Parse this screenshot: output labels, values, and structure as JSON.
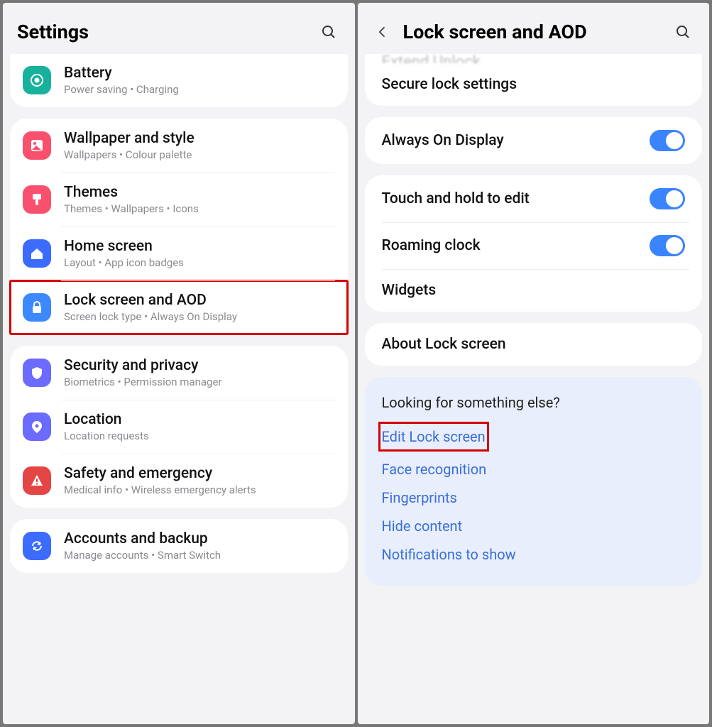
{
  "left": {
    "title": "Settings",
    "items": [
      {
        "id": "battery",
        "label": "Battery",
        "sub": "Power saving  •  Charging",
        "icon": "battery",
        "color": "bg-teal",
        "group": 0
      },
      {
        "id": "wallpaper",
        "label": "Wallpaper and style",
        "sub": "Wallpapers  •  Colour palette",
        "icon": "image",
        "color": "bg-pink",
        "group": 1
      },
      {
        "id": "themes",
        "label": "Themes",
        "sub": "Themes  •  Wallpapers  •  Icons",
        "icon": "brush",
        "color": "bg-pink2",
        "group": 1
      },
      {
        "id": "home",
        "label": "Home screen",
        "sub": "Layout  •  App icon badges",
        "icon": "home",
        "color": "bg-blue",
        "group": 1
      },
      {
        "id": "lockscreen",
        "label": "Lock screen and AOD",
        "sub": "Screen lock type  •  Always On Display",
        "icon": "lock",
        "color": "bg-blue2",
        "group": 1,
        "highlight": true
      },
      {
        "id": "security",
        "label": "Security and privacy",
        "sub": "Biometrics  •  Permission manager",
        "icon": "shield",
        "color": "bg-violet",
        "group": 2
      },
      {
        "id": "location",
        "label": "Location",
        "sub": "Location requests",
        "icon": "pin",
        "color": "bg-violet",
        "group": 2
      },
      {
        "id": "safety",
        "label": "Safety and emergency",
        "sub": "Medical info  •  Wireless emergency alerts",
        "icon": "alert",
        "color": "bg-red",
        "group": 2
      },
      {
        "id": "accounts",
        "label": "Accounts and backup",
        "sub": "Manage accounts  •  Smart Switch",
        "icon": "sync",
        "color": "bg-blue",
        "group": 3
      }
    ]
  },
  "right": {
    "title": "Lock screen and AOD",
    "cutoff_hint": "Extend Unlock",
    "rows": [
      {
        "id": "secure",
        "label": "Secure lock settings",
        "type": "nav",
        "group": 0
      },
      {
        "id": "aod",
        "label": "Always On Display",
        "type": "switch",
        "value": true,
        "group": 1
      },
      {
        "id": "touchhold",
        "label": "Touch and hold to edit",
        "type": "switch",
        "value": true,
        "group": 2
      },
      {
        "id": "roaming",
        "label": "Roaming clock",
        "type": "switch",
        "value": true,
        "group": 2
      },
      {
        "id": "widgets",
        "label": "Widgets",
        "type": "nav",
        "group": 2
      },
      {
        "id": "about",
        "label": "About Lock screen",
        "type": "nav",
        "group": 3
      }
    ],
    "suggest": {
      "title": "Looking for something else?",
      "links": [
        {
          "id": "edit",
          "label": "Edit Lock screen",
          "highlight": true
        },
        {
          "id": "face",
          "label": "Face recognition"
        },
        {
          "id": "finger",
          "label": "Fingerprints"
        },
        {
          "id": "hide",
          "label": "Hide content"
        },
        {
          "id": "notif",
          "label": "Notifications to show"
        }
      ]
    }
  }
}
